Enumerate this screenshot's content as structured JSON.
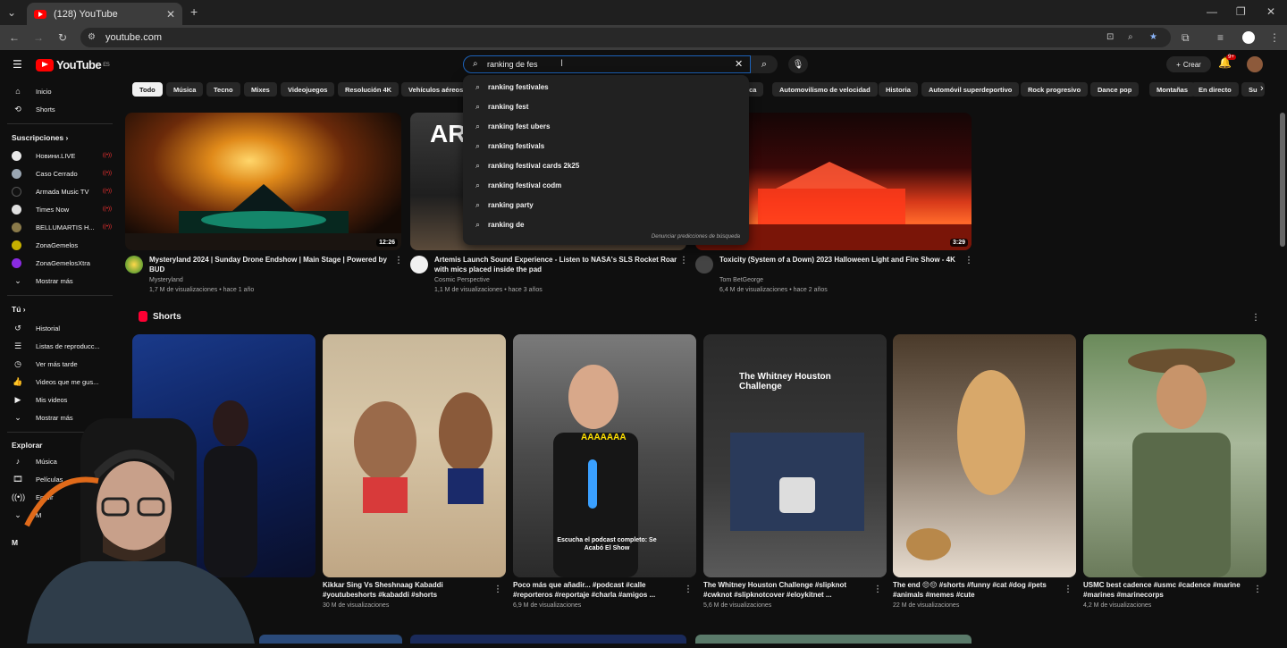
{
  "browser": {
    "tab_title": "(128) YouTube",
    "tab_close": "✕",
    "new_tab": "+",
    "url": "youtube.com",
    "window_controls": [
      "—",
      "❐",
      "✕"
    ]
  },
  "masthead": {
    "logo_text": "YouTube",
    "logo_country": "ES",
    "search_value": "ranking de fes",
    "create_label": "Crear",
    "notif_badge": "9+",
    "search_clear": "✕"
  },
  "sidebar": {
    "main": [
      {
        "label": "Inicio",
        "icon": "home-icon"
      },
      {
        "label": "Shorts",
        "icon": "shorts-icon"
      }
    ],
    "subs_header": "Suscripciones",
    "subs": [
      {
        "label": "Новини.LIVE",
        "color": "#e8e8e8"
      },
      {
        "label": "Caso Cerrado",
        "color": "#9aa6b2"
      },
      {
        "label": "Armada Music TV",
        "color": "#111111"
      },
      {
        "label": "Times Now",
        "color": "#e0e0e0"
      },
      {
        "label": "BELLUMARTIS H...",
        "color": "#8a7a4a"
      },
      {
        "label": "ZonaGemelos",
        "color": "#c6b000"
      },
      {
        "label": "ZonaGemelosXtra",
        "color": "#8a2be2"
      }
    ],
    "subs_more": "Mostrar más",
    "you_header": "Tú",
    "you": [
      {
        "label": "Historial",
        "icon": "history-icon"
      },
      {
        "label": "Listas de reproducc...",
        "icon": "playlist-icon"
      },
      {
        "label": "Ver más tarde",
        "icon": "watch-later-icon"
      },
      {
        "label": "Videos que me gus...",
        "icon": "like-icon"
      },
      {
        "label": "Mis videos",
        "icon": "my-videos-icon"
      },
      {
        "label": "Mostrar más",
        "icon": "chevron-down-icon"
      }
    ],
    "explore_header": "Explorar",
    "explore": [
      {
        "label": "Música",
        "icon": "music-icon"
      },
      {
        "label": "Películas",
        "icon": "movies-icon"
      },
      {
        "label": "En dir",
        "icon": "live-icon"
      },
      {
        "label": "M",
        "icon": "chevron-down-icon"
      }
    ],
    "more_header": "M"
  },
  "chips": [
    "Todo",
    "Música",
    "Tecno",
    "Mixes",
    "Videojuegos",
    "Resolución 4K",
    "Vehículos aéreos",
    "ica",
    "Automovilismo de velocidad",
    "Historia",
    "Automóvil superdeportivo",
    "Rock progresivo",
    "Dance pop",
    "Montañas",
    "En directo",
    "Su"
  ],
  "suggestions": [
    "ranking festivales",
    "ranking fest",
    "ranking fest ubers",
    "ranking festivals",
    "ranking festival cards 2k25",
    "ranking festival codm",
    "ranking party",
    "ranking de"
  ],
  "suggest_report": "Denunciar predicciones de búsqueda",
  "videos": [
    {
      "title": "Mysteryland 2024 | Sunday Drone Endshow | Main Stage | Powered by BUD",
      "channel": "Mysteryland",
      "meta": "1,7 M de visualizaciones • hace 1 año",
      "duration": "12:26"
    },
    {
      "title": "Artemis Launch Sound Experience - Listen to NASA's SLS Rocket Roar with mics placed inside the pad",
      "channel": "Cosmic Perspective",
      "meta": "1,1 M de visualizaciones • hace 3 años",
      "duration": "",
      "thumb_text": "AR"
    },
    {
      "title": "Toxicity (System of a Down) 2023 Halloween Light and Fire Show - 4K",
      "channel": "Tom BetGeorge",
      "meta": "6,4 M de visualizaciones • hace 2 años",
      "duration": "3:29"
    }
  ],
  "shorts_header": "Shorts",
  "shorts": [
    {
      "title": "",
      "meta": ""
    },
    {
      "title": "Kikkar Sing Vs Sheshnaag Kabaddi #youtubeshorts #kabaddi #shorts",
      "meta": "30 M de visualizaciones"
    },
    {
      "title": "Poco más que añadir... #podcast #calle #reporteros #reportaje #charla #amigos ...",
      "meta": "6,9 M de visualizaciones",
      "overlay_top": "AAAAAAA",
      "overlay_bottom": "Escucha el podcast completo: Se Acabó El Show"
    },
    {
      "title": "The Whitney Houston Challenge #slipknot #cwknot #slipknotcover #eloykitnet ...",
      "meta": "5,6 M de visualizaciones",
      "overlay_top": "The Whitney Houston Challenge"
    },
    {
      "title": "The end 😔😔 #shorts #funny #cat #dog #pets #animals #memes #cute",
      "meta": "22 M de visualizaciones"
    },
    {
      "title": "USMC best cadence #usmc #cadence #marine #marines #marinecorps",
      "meta": "4,2 M de visualizaciones"
    }
  ],
  "colors": {
    "accent": "#ff0000",
    "background": "#0f0f0f",
    "search_focus": "#1c62b9"
  }
}
